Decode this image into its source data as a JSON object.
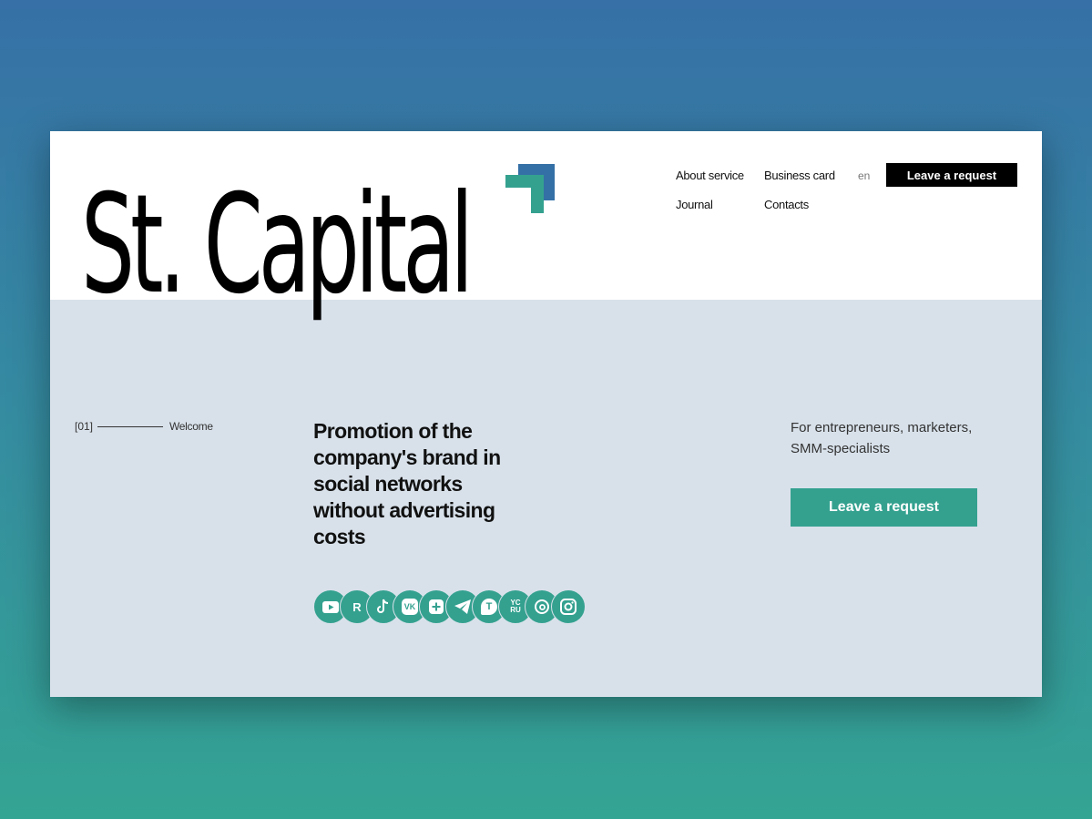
{
  "brand": {
    "name": "St. Capital",
    "colors": {
      "accent": "#34a18f",
      "brand_blue": "#3470a6",
      "surface": "#d8e1ea"
    }
  },
  "nav": {
    "items": [
      "About service",
      "Business card",
      "Journal",
      "Contacts"
    ],
    "language": "en",
    "cta_label": "Leave a request"
  },
  "hero": {
    "section_number": "[01]",
    "section_label": "Welcome",
    "headline": "Promotion of the company's brand in social networks without advertising costs",
    "audience": "For entrepreneurs, marketers, SMM-specialists",
    "cta_label": "Leave a request",
    "socials": [
      {
        "icon": "youtube-icon"
      },
      {
        "icon": "rutube-icon",
        "glyph": "R"
      },
      {
        "icon": "tiktok-icon"
      },
      {
        "icon": "vk-icon",
        "glyph": "VK"
      },
      {
        "icon": "plus-square-icon"
      },
      {
        "icon": "telegram-icon"
      },
      {
        "icon": "tenchat-icon",
        "glyph": "T"
      },
      {
        "icon": "yappy-icon",
        "glyph": "YC RU"
      },
      {
        "icon": "threads-icon"
      },
      {
        "icon": "instagram-icon"
      }
    ]
  }
}
